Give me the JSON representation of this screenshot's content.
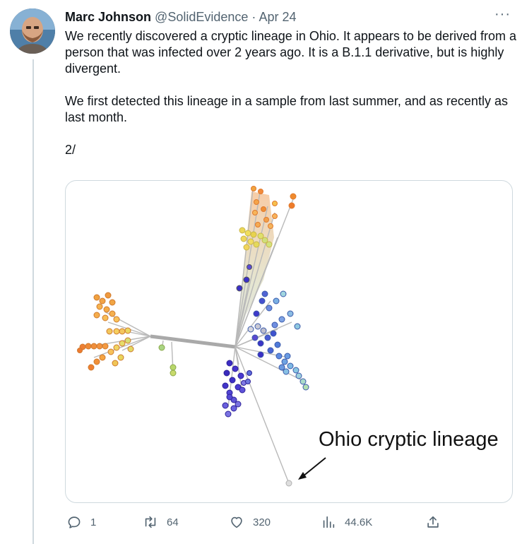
{
  "tweet": {
    "author_name": "Marc Johnson",
    "handle": "@SolidEvidence",
    "separator": "·",
    "date": "Apr 24",
    "more": "···",
    "paragraphs": [
      "We recently discovered a cryptic lineage in Ohio. It appears to be derived from a person that was infected over 2 years ago.  It is a B.1.1 derivative, but is highly divergent.",
      "We first detected this lineage in a sample from last summer, and as recently as last month.",
      "2/"
    ]
  },
  "media": {
    "annotation": "Ohio cryptic lineage"
  },
  "actions": {
    "replies": "1",
    "retweets": "64",
    "likes": "320",
    "views": "44.6K"
  },
  "icons": [
    "reply-icon",
    "retweet-icon",
    "like-icon",
    "views-icon",
    "share-icon",
    "more-icon"
  ],
  "colors": {
    "text": "#0f1419",
    "secondary": "#536471",
    "border": "#cfd9de"
  }
}
